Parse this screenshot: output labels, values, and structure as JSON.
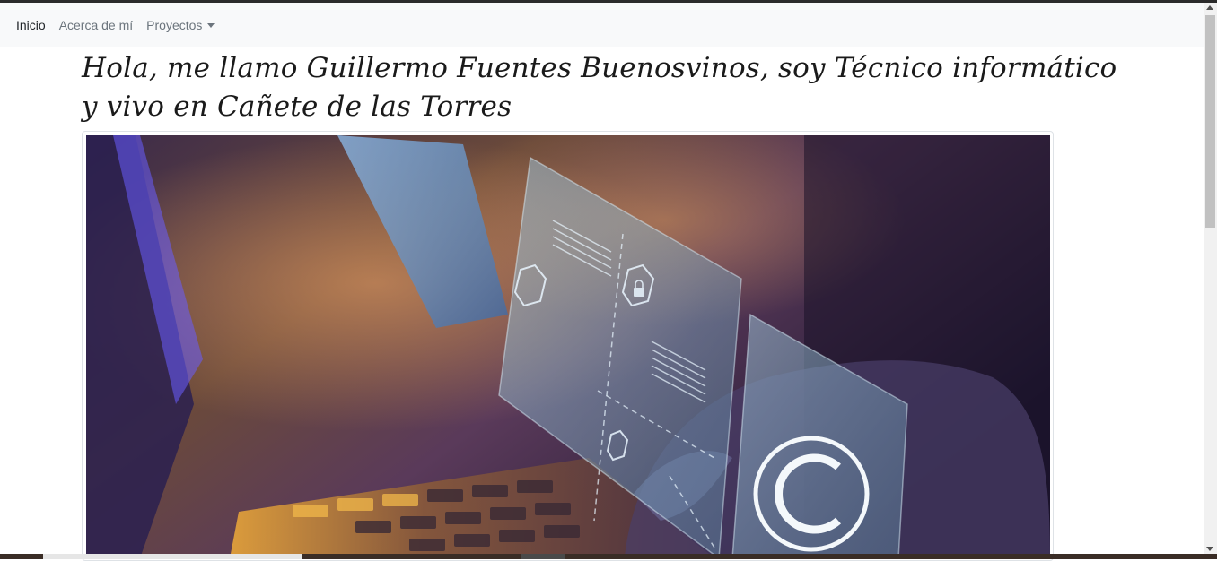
{
  "navbar": {
    "items": [
      {
        "label": "Inicio"
      },
      {
        "label": "Acerca de mí"
      },
      {
        "label": "Proyectos"
      }
    ]
  },
  "main": {
    "heading": "Hola, me llamo Guillermo Fuentes Buenosvinos, soy Técnico informático y vivo en Cañete de las Torres"
  },
  "image": {
    "icons": [
      "copyright-icon",
      "lock-icon",
      "people-icon",
      "shield-icon"
    ]
  },
  "colors": {
    "navbar_bg": "#f8f9fa",
    "nav_active": "#212529",
    "nav_muted": "#6c757d",
    "heading_text": "#1a1a1a"
  }
}
